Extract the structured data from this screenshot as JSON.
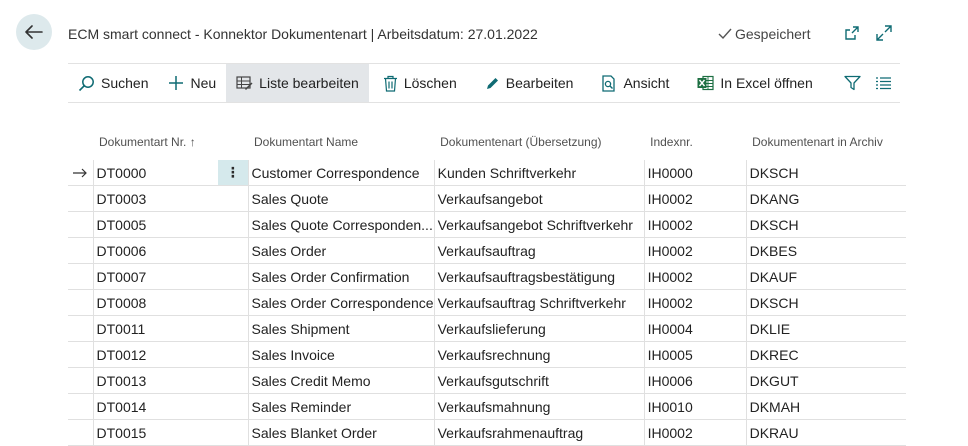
{
  "header": {
    "title": "ECM smart connect - Konnektor Dokumentenart | Arbeitsdatum: 27.01.2022",
    "saved_label": "Gespeichert"
  },
  "toolbar": {
    "search": "Suchen",
    "new": "Neu",
    "edit_list": "Liste bearbeiten",
    "delete": "Löschen",
    "edit": "Bearbeiten",
    "view": "Ansicht",
    "excel": "In Excel öffnen"
  },
  "table": {
    "columns": {
      "nr": "Dokumentart Nr. ↑",
      "name": "Dokumentart Name",
      "translation": "Dokumentenart (Übersetzung)",
      "index": "Indexnr.",
      "archive": "Dokumentenart in Archiv"
    },
    "rows": [
      {
        "nr": "DT0000",
        "name": "Customer Correspondence",
        "translation": "Kunden Schriftverkehr",
        "index": "IH0000",
        "archive": "DKSCH"
      },
      {
        "nr": "DT0003",
        "name": "Sales Quote",
        "translation": "Verkaufsangebot",
        "index": "IH0002",
        "archive": "DKANG"
      },
      {
        "nr": "DT0005",
        "name": "Sales Quote Corresponden...",
        "translation": "Verkaufsangebot Schriftverkehr",
        "index": "IH0002",
        "archive": "DKSCH"
      },
      {
        "nr": "DT0006",
        "name": "Sales Order",
        "translation": "Verkaufsauftrag",
        "index": "IH0002",
        "archive": "DKBES"
      },
      {
        "nr": "DT0007",
        "name": "Sales Order Confirmation",
        "translation": "Verkaufsauftragsbestätigung",
        "index": "IH0002",
        "archive": "DKAUF"
      },
      {
        "nr": "DT0008",
        "name": "Sales Order Correspondence",
        "translation": "Verkaufsauftrag Schriftverkehr",
        "index": "IH0002",
        "archive": "DKSCH"
      },
      {
        "nr": "DT0011",
        "name": "Sales Shipment",
        "translation": "Verkaufslieferung",
        "index": "IH0004",
        "archive": "DKLIE"
      },
      {
        "nr": "DT0012",
        "name": "Sales Invoice",
        "translation": "Verkaufsrechnung",
        "index": "IH0005",
        "archive": "DKREC"
      },
      {
        "nr": "DT0013",
        "name": "Sales Credit Memo",
        "translation": "Verkaufsgutschrift",
        "index": "IH0006",
        "archive": "DKGUT"
      },
      {
        "nr": "DT0014",
        "name": "Sales Reminder",
        "translation": "Verkaufsmahnung",
        "index": "IH0010",
        "archive": "DKMAH"
      },
      {
        "nr": "DT0015",
        "name": "Sales Blanket Order",
        "translation": "Verkaufsrahmenauftrag",
        "index": "IH0002",
        "archive": "DKRAU"
      }
    ]
  },
  "colors": {
    "accent": "#0f6b73",
    "selected_row_bg": "#d5e9ec",
    "toolbar_active_bg": "#e3e6e9",
    "excel_green": "#1d6f42"
  }
}
